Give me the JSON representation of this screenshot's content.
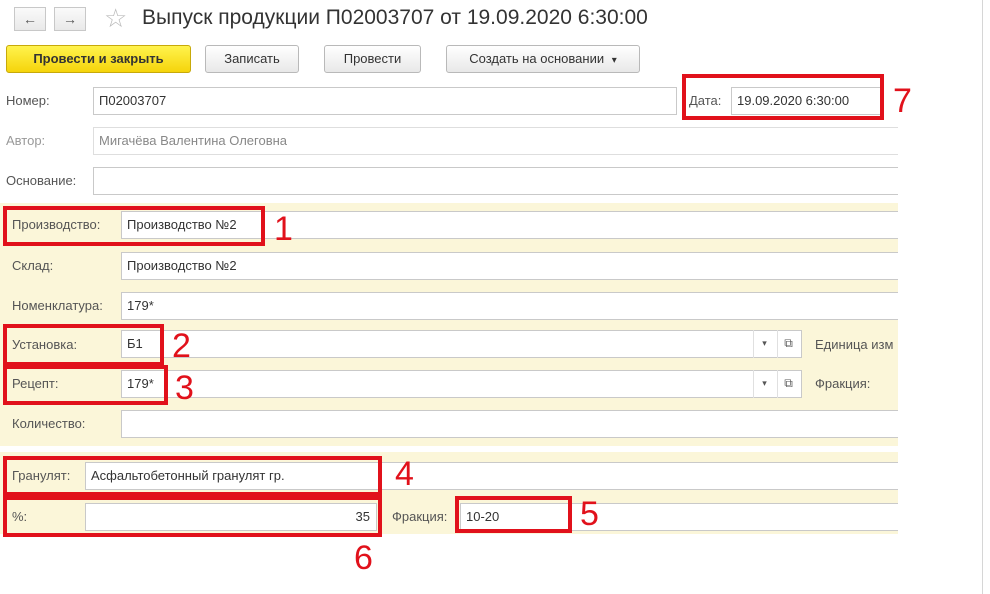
{
  "window": {
    "title": "Выпуск продукции П02003707 от 19.09.2020 6:30:00",
    "back_icon": "←",
    "forward_icon": "→",
    "star_icon": "☆"
  },
  "toolbar": {
    "post_close_label": "Провести и закрыть",
    "save_label": "Записать",
    "post_label": "Провести",
    "create_based_label": "Создать на основании",
    "create_based_arrow": "▾"
  },
  "header": {
    "number_label": "Номер:",
    "number_value": "П02003707",
    "date_label": "Дата:",
    "date_value": "19.09.2020  6:30:00",
    "author_label": "Автор:",
    "author_value": "Мигачёва Валентина Олеговна",
    "basis_label": "Основание:",
    "basis_value": ""
  },
  "production": {
    "production_label": "Производство:",
    "production_value": "Производство №2",
    "warehouse_label": "Склад:",
    "warehouse_value": "Производство №2",
    "nomenclature_label": "Номенклатура:",
    "nomenclature_value": "179*",
    "installation_label": "Установка:",
    "installation_value": "Б1",
    "unit_label": "Единица изм",
    "recipe_label": "Рецепт:",
    "recipe_value": "179*",
    "fraction_label": "Фракция:",
    "quantity_label": "Количество:",
    "quantity_value": "",
    "dropdown_icon": "▾",
    "open_icon": "⧉"
  },
  "granulate": {
    "granulate_label": "Гранулят:",
    "granulate_value": "Асфальтобетонный гранулят гр.",
    "percent_label": "%:",
    "percent_value": "35",
    "fraction_label": "Фракция:",
    "fraction_value": "10-20"
  },
  "annotations": {
    "n1": "1",
    "n2": "2",
    "n3": "3",
    "n4": "4",
    "n5": "5",
    "n6": "6",
    "n7": "7",
    "color": "#e1111b"
  }
}
